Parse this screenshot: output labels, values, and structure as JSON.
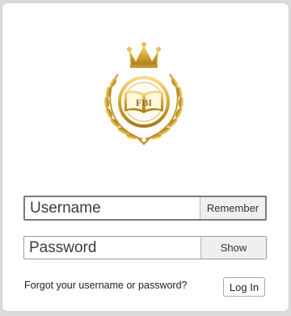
{
  "logo": {
    "monogram": "FBI",
    "icon": "crest-with-crown-and-laurel"
  },
  "login": {
    "username_placeholder": "Username",
    "username_value": "",
    "remember_label": "Remember",
    "password_placeholder": "Password",
    "password_value": "",
    "show_label": "Show",
    "forgot_text": "Forgot your username or password?",
    "login_label": "Log In"
  },
  "colors": {
    "gold": "#d4a52c",
    "gold_light": "#f3d77a",
    "field_border": "#9b9b9b",
    "button_bg": "#efefef"
  }
}
